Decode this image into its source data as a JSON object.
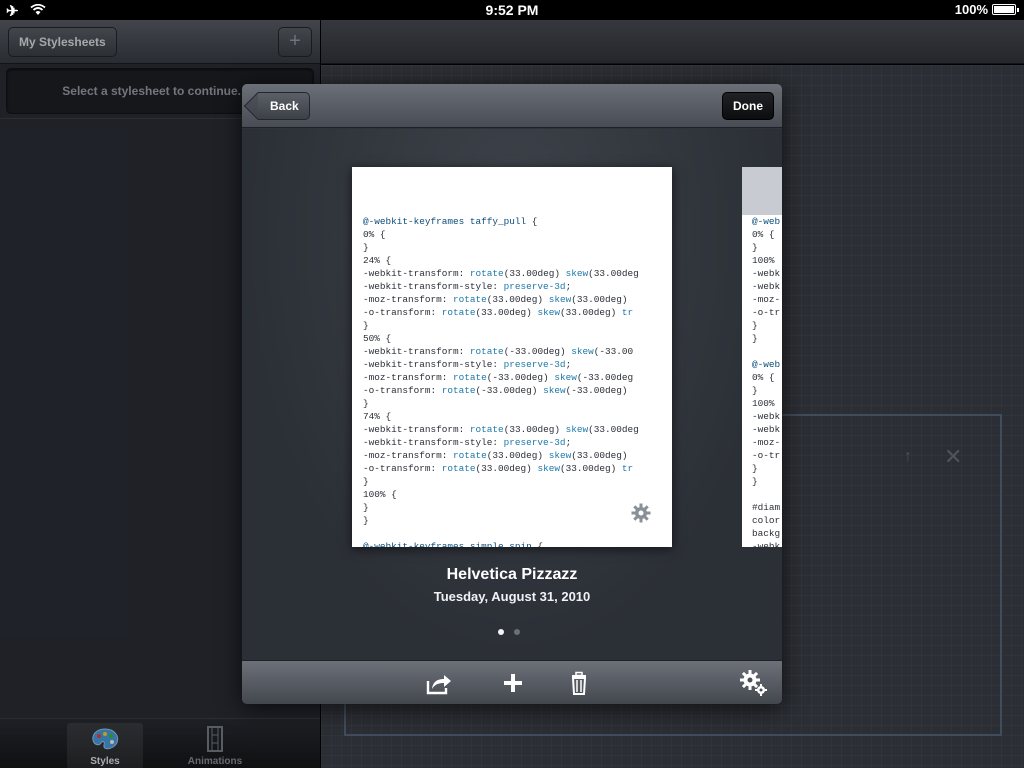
{
  "status_bar": {
    "time": "9:52 PM",
    "battery": "100%"
  },
  "master": {
    "nav_button": "My Stylesheets",
    "add_button": "+",
    "message": "Select a stylesheet to continue."
  },
  "tabs": [
    {
      "label": "Styles",
      "icon": "palette-icon",
      "active": true
    },
    {
      "label": "Animations",
      "icon": "film-icon",
      "active": false
    }
  ],
  "popover": {
    "back_label": "Back",
    "done_label": "Done",
    "current_index": 1,
    "page_count": 2,
    "stylesheet": {
      "title": "Helvetica Pizzazz",
      "date": "Tuesday, August 31, 2010"
    },
    "preview_code": [
      "@-webkit-keyframes taffy_pull {",
      "0% {",
      "}",
      "24% {",
      "-webkit-transform: rotate(33.00deg) skew(33.00deg",
      "-webkit-transform-style: preserve-3d;",
      "-moz-transform: rotate(33.00deg) skew(33.00deg)",
      "-o-transform: rotate(33.00deg) skew(33.00deg) tr",
      "}",
      "50% {",
      "-webkit-transform: rotate(-33.00deg) skew(-33.00",
      "-webkit-transform-style: preserve-3d;",
      "-moz-transform: rotate(-33.00deg) skew(-33.00deg",
      "-o-transform: rotate(-33.00deg) skew(-33.00deg)",
      "}",
      "74% {",
      "-webkit-transform: rotate(33.00deg) skew(33.00deg",
      "-webkit-transform-style: preserve-3d;",
      "-moz-transform: rotate(33.00deg) skew(33.00deg)",
      "-o-transform: rotate(33.00deg) skew(33.00deg) tr",
      "}",
      "100% {",
      "}",
      "}",
      "",
      "@-webkit-keyframes simple_spin {"
    ],
    "next_preview_code": [
      "@-web",
      "0% {",
      "}",
      "100%",
      "-webk",
      "-webk",
      "-moz-",
      "-o-tr",
      "}",
      "}",
      "",
      "@-web",
      "0% {",
      "}",
      "100%",
      "-webk",
      "-webk",
      "-moz-",
      "-o-tr",
      "}",
      "}",
      "",
      "#diam",
      "color",
      "backg",
      "-webk"
    ],
    "toolbar": [
      "share-icon",
      "add-icon",
      "trash-icon",
      "settings-gear-icon"
    ]
  }
}
